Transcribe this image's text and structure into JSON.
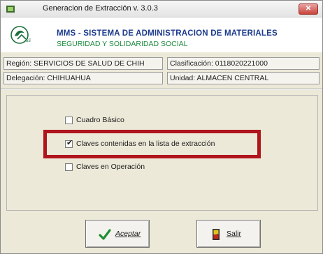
{
  "window": {
    "title": "Generacion de Extracción v. 3.0.3",
    "close_label": "✕"
  },
  "header": {
    "system_title": "MMS - SISTEMA DE ADMINISTRACION DE MATERIALES",
    "system_subtitle": "SEGURIDAD Y SOLIDARIDAD SOCIAL",
    "logo": "imss-eagle-logo"
  },
  "info": {
    "region": "Región: SERVICIOS DE SALUD DE CHIH",
    "clasificacion": "Clasificación: 0118020221000",
    "delegacion": "Delegación: CHIHUAHUA",
    "unidad": "Unidad: ALMACEN CENTRAL"
  },
  "options": [
    {
      "label": "Cuadro Básico",
      "checked": false
    },
    {
      "label": "Claves contenidas en la lista de extracción",
      "checked": true
    },
    {
      "label": "Claves en Operación",
      "checked": false
    }
  ],
  "checkmark_glyph": "✔",
  "buttons": {
    "accept": {
      "label": "Aceptar",
      "icon": "check-icon",
      "color": "#1f8f2f"
    },
    "exit": {
      "label": "Salir",
      "icon": "door-exit-icon"
    }
  },
  "colors": {
    "highlight": "#b0151c",
    "title_blue": "#1b3a8c",
    "subtitle_green": "#1c8a3c"
  }
}
